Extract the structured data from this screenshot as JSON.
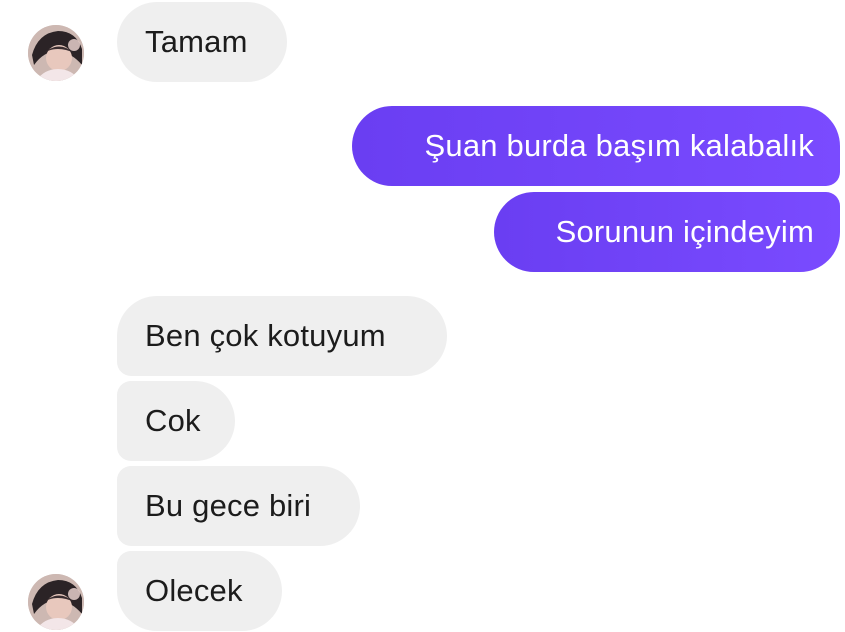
{
  "conversation": {
    "messages": [
      {
        "text": "Tamam",
        "direction": "incoming"
      },
      {
        "text": "Şuan burda başım kalabalık",
        "direction": "outgoing"
      },
      {
        "text": "Sorunun içindeyim",
        "direction": "outgoing"
      },
      {
        "text": "Ben çok kotuyum",
        "direction": "incoming"
      },
      {
        "text": "Cok",
        "direction": "incoming"
      },
      {
        "text": "Bu gece biri",
        "direction": "incoming"
      },
      {
        "text": "Olecek",
        "direction": "incoming"
      }
    ],
    "colors": {
      "incoming_bubble": "#efefef",
      "outgoing_bubble": "#7647ff",
      "incoming_text": "#1c1c1c",
      "outgoing_text": "#ffffff"
    },
    "avatar_icon": "contact-avatar-photo"
  }
}
